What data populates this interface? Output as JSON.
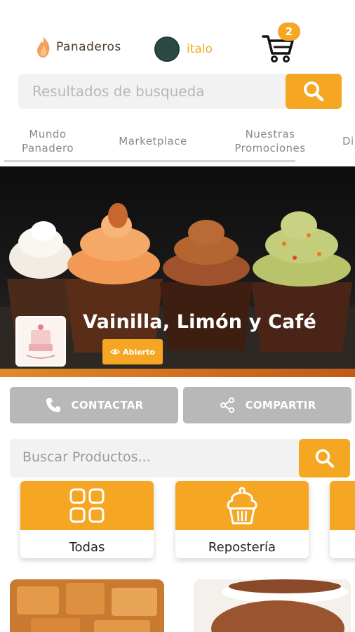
{
  "header": {
    "brand_name": "Panaderos",
    "user_name": "italo",
    "cart_count": "2"
  },
  "search": {
    "placeholder": "Resultados de busqueda"
  },
  "nav": {
    "items": [
      {
        "line1": "Mundo",
        "line2": "Panadero"
      },
      {
        "line1": "Marketplace",
        "line2": ""
      },
      {
        "line1": "Nuestras",
        "line2": "Promociones"
      },
      {
        "line1": "Di",
        "line2": ""
      }
    ]
  },
  "shop": {
    "title": "Vainilla, Limón y Café",
    "status": "Abierto"
  },
  "actions": {
    "contact": "CONTACTAR",
    "share": "COMPARTIR"
  },
  "product_search": {
    "placeholder": "Buscar Productos..."
  },
  "categories": [
    {
      "label": "Todas",
      "icon": "grid-icon"
    },
    {
      "label": "Repostería",
      "icon": "cupcake-icon"
    }
  ],
  "colors": {
    "accent": "#f5a623",
    "button_gray": "#b8b8b8"
  }
}
